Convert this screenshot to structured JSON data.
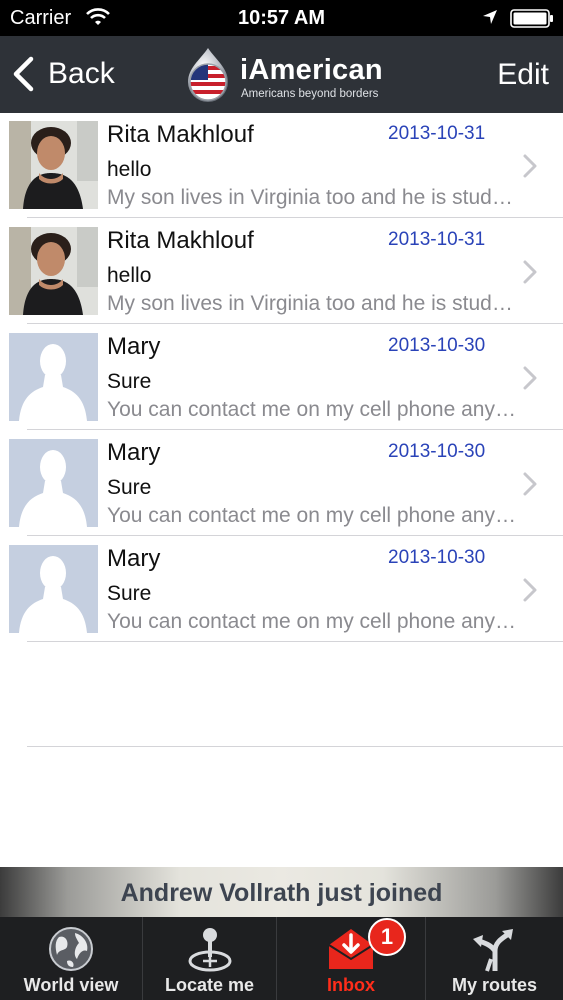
{
  "status_bar": {
    "carrier": "Carrier",
    "time": "10:57 AM"
  },
  "nav": {
    "back_label": "Back",
    "brand": "iAmerican",
    "tagline": "Americans beyond borders",
    "edit_label": "Edit"
  },
  "messages": [
    {
      "name": "Rita Makhlouf",
      "date": "2013-10-31",
      "subject": "hello",
      "preview": "My son lives in Virginia too and he is studying there",
      "avatar": "photo"
    },
    {
      "name": "Rita Makhlouf",
      "date": "2013-10-31",
      "subject": "hello",
      "preview": "My son lives in Virginia too and he is studying there",
      "avatar": "photo"
    },
    {
      "name": "Mary",
      "date": "2013-10-30",
      "subject": "Sure",
      "preview": "You can contact me on my cell phone anytime",
      "avatar": "placeholder"
    },
    {
      "name": "Mary",
      "date": "2013-10-30",
      "subject": "Sure",
      "preview": "You can contact me on my cell phone anytime",
      "avatar": "placeholder"
    },
    {
      "name": "Mary",
      "date": "2013-10-30",
      "subject": "Sure",
      "preview": "You can contact me on my cell phone anytime",
      "avatar": "placeholder"
    }
  ],
  "banner": {
    "text": "Andrew Vollrath just joined"
  },
  "tabs": [
    {
      "label": "World view",
      "icon": "globe-icon"
    },
    {
      "label": "Locate me",
      "icon": "joystick-icon"
    },
    {
      "label": "Inbox",
      "icon": "inbox-icon",
      "active": true
    },
    {
      "label": "My routes",
      "icon": "routes-icon"
    }
  ],
  "inbox_badge": "1",
  "colors": {
    "nav_bg": "#2e3238",
    "date_blue": "#2a43b8",
    "active_red": "#ff2d1a",
    "badge_red": "#e8261c"
  }
}
